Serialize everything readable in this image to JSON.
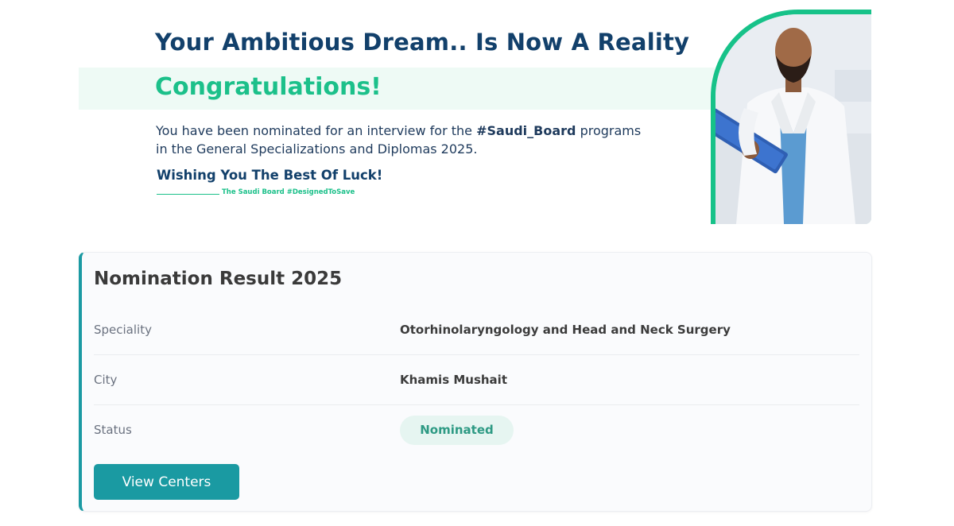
{
  "hero": {
    "headline": "Your Ambitious Dream.. Is Now A Reality",
    "congrats": "Congratulations!",
    "message_before": "You have been nominated for an interview for the ",
    "message_hashtag": "#Saudi_Board",
    "message_after": " programs in the General Specializations and Diplomas 2025.",
    "wishing": "Wishing You The Best Of Luck!",
    "signature": "The Saudi Board #DesignedToSave"
  },
  "result": {
    "title": "Nomination Result 2025",
    "rows": [
      {
        "label": "Speciality",
        "value": "Otorhinolaryngology and Head and Neck Surgery"
      },
      {
        "label": "City",
        "value": "Khamis Mushait"
      },
      {
        "label": "Status",
        "value": "Nominated"
      }
    ],
    "button_label": "View Centers"
  },
  "colors": {
    "navy": "#12406b",
    "green": "#1cc08a",
    "teal": "#1a9aa2",
    "badge_bg": "#e6f5f1",
    "badge_text": "#2e9a84"
  }
}
